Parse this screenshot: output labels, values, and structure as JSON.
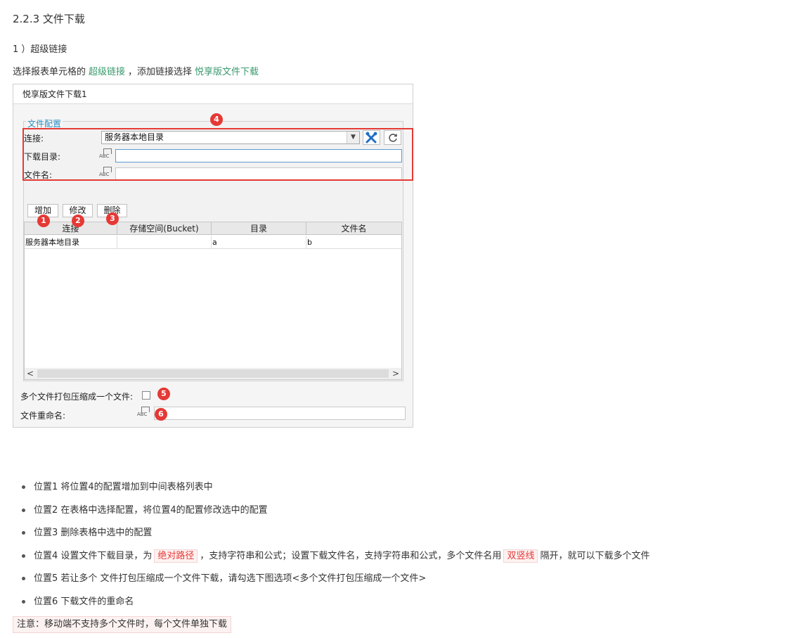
{
  "doc": {
    "heading": "2.2.3 文件下载",
    "sub": "1 ）超级链接",
    "intro": {
      "prefix": "选择报表单元格的",
      "link1": "超级链接",
      "middle": "，添加链接选择",
      "link2": "悦享版文件下载"
    }
  },
  "dialog": {
    "title": "悦享版文件下载1",
    "group_label": "文件配置",
    "connection_label": "连接:",
    "connection_value": "服务器本地目录",
    "download_dir_label": "下载目录:",
    "filename_label": "文件名:",
    "formula_icon": "ABC",
    "buttons": {
      "add": "增加",
      "modify": "修改",
      "delete": "删除"
    },
    "table": {
      "headers": [
        "连接",
        "存储空间(Bucket)",
        "目录",
        "文件名"
      ],
      "rows": [
        [
          "服务器本地目录",
          "",
          "a",
          "b"
        ]
      ]
    },
    "scroll_left": "<",
    "scroll_right": ">",
    "zip_label": "多个文件打包压缩成一个文件:",
    "zip_checked": false,
    "rename_label": "文件重命名:",
    "markers": [
      "1",
      "2",
      "3",
      "4",
      "5",
      "6"
    ],
    "colors": {
      "marker": "#e53935",
      "link": "#3a9a6e",
      "group": "#2a8ec5"
    }
  },
  "bullets": [
    {
      "text": "位置1 将位置4的配置增加到中间表格列表中"
    },
    {
      "text": "位置2 在表格中选择配置，将位置4的配置修改选中的配置"
    },
    {
      "text": "位置3 删除表格中选中的配置"
    },
    {
      "p1": "位置4 设置文件下载目录，为",
      "c1": "绝对路径",
      "p2": "，支持字符串和公式；设置下载文件名，支持字符串和公式，多个文件名用",
      "c2": "双竖线",
      "p3": "隔开，就可以下载多个文件"
    },
    {
      "text": "位置5 若让多个 文件打包压缩成一个文件下载，请勾选下图选项<多个文件打包压缩成一个文件>"
    },
    {
      "text": "位置6 下载文件的重命名"
    }
  ],
  "note": "注意：移动端不支持多个文件时，每个文件单独下载"
}
